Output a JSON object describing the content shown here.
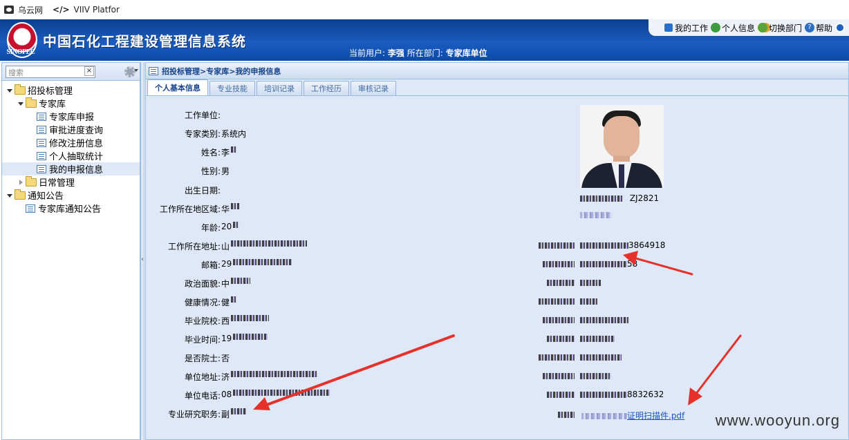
{
  "browser": {
    "tab1": "乌云网",
    "tab2_code": "</>",
    "tab2": "VIIV Platfor"
  },
  "header": {
    "logo_text": "SINOPEC",
    "title": "中国石化工程建设管理信息系统",
    "current_user_label": "当前用户:",
    "current_user": "李强",
    "dept_label": "所在部门:",
    "dept": "专家库单位",
    "toolbar": {
      "my_work": "我的工作",
      "personal_info": "个人信息",
      "switch_dept": "切换部门",
      "help": "帮助"
    }
  },
  "sidebar": {
    "search_placeholder": "搜索",
    "clear": "×",
    "tree": [
      {
        "label": "招投标管理",
        "level": 0,
        "type": "folder",
        "open": true
      },
      {
        "label": "专家库",
        "level": 1,
        "type": "folder",
        "open": true
      },
      {
        "label": "专家库申报",
        "level": 2,
        "type": "leaf"
      },
      {
        "label": "审批进度查询",
        "level": 2,
        "type": "leaf"
      },
      {
        "label": "修改注册信息",
        "level": 2,
        "type": "leaf"
      },
      {
        "label": "个人抽取统计",
        "level": 2,
        "type": "leaf"
      },
      {
        "label": "我的申报信息",
        "level": 2,
        "type": "leaf",
        "selected": true
      },
      {
        "label": "日常管理",
        "level": 1,
        "type": "folder",
        "open": false
      },
      {
        "label": "通知公告",
        "level": 0,
        "type": "folder",
        "open": true
      },
      {
        "label": "专家库通知公告",
        "level": 1,
        "type": "leaf"
      }
    ]
  },
  "main": {
    "breadcrumb": "招投标管理>专家库>我的申报信息",
    "tabs": [
      "个人基本信息",
      "专业技能",
      "培训记录",
      "工作经历",
      "审核记录"
    ],
    "fields_left": [
      {
        "label": "工作单位:",
        "value": ""
      },
      {
        "label": "专家类别:",
        "value": "系统内"
      },
      {
        "label": "姓名:",
        "value": "李"
      },
      {
        "label": "性别:",
        "value": "男"
      },
      {
        "label": "出生日期:",
        "value": ""
      },
      {
        "label": "工作所在地区域:",
        "value": "华"
      },
      {
        "label": "年龄:",
        "value": "20"
      },
      {
        "label": "工作所在地址:",
        "value": "山"
      },
      {
        "label": "邮箱:",
        "value": "29"
      },
      {
        "label": "政治面貌:",
        "value": "中"
      },
      {
        "label": "健康情况:",
        "value": "健"
      },
      {
        "label": "毕业院校:",
        "value": "西"
      },
      {
        "label": "毕业时间:",
        "value": "19"
      },
      {
        "label": "是否院士:",
        "value": "否"
      },
      {
        "label": "单位地址:",
        "value": "济"
      },
      {
        "label": "单位电话:",
        "value": "08"
      },
      {
        "label": "专业研究职务:",
        "value": "副"
      }
    ],
    "right_values": [
      "3864918",
      "58",
      "",
      "",
      "",
      "",
      "",
      "",
      "8832632"
    ],
    "expert_id": "ZJ2821",
    "pdf_link_suffix": "证明扫描件.pdf"
  },
  "watermark": "www.wooyun.org"
}
